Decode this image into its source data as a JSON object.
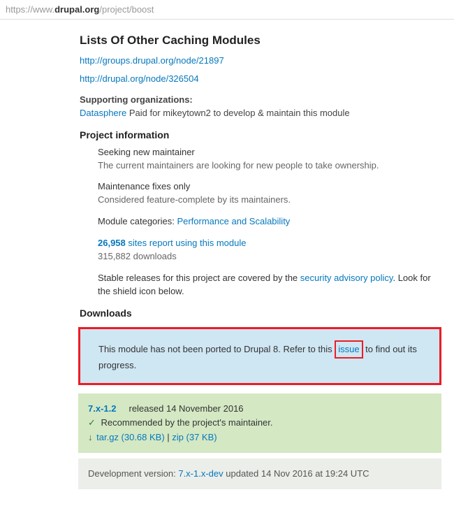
{
  "url": {
    "prefix": "https://www.",
    "domain": "drupal.org",
    "path": "/project/boost"
  },
  "headings": {
    "other_modules": "Lists Of Other Caching Modules",
    "project_info": "Project information",
    "downloads": "Downloads"
  },
  "links": {
    "other1": "http://groups.drupal.org/node/21897",
    "other2": "http://drupal.org/node/326504"
  },
  "supporting": {
    "label": "Supporting organizations:",
    "org": "Datasphere",
    "note": " Paid for mikeytown2 to develop & maintain this module"
  },
  "info": {
    "maintainer_title": "Seeking new maintainer",
    "maintainer_desc": "The current maintainers are looking for new people to take ownership.",
    "fixes_title": "Maintenance fixes only",
    "fixes_desc": "Considered feature-complete by its maintainers.",
    "categories_label": "Module categories: ",
    "category_link": "Performance and Scalability",
    "usage_number": "26,958",
    "usage_text": " sites report using this module",
    "downloads_count": "315,882 downloads",
    "security_pre": "Stable releases for this project are covered by the ",
    "security_link": "security advisory policy",
    "security_post": ". Look for the shield icon below."
  },
  "notice": {
    "pre": "This module has not been ported to Drupal 8. Refer to this ",
    "issue": "issue",
    "post": " to find out its progress."
  },
  "release": {
    "version": "7.x-1.2",
    "released": "released 14 November 2016",
    "recommended": " Recommended by the project's maintainer.",
    "tar_label": "tar.gz (30.68 KB)",
    "sep": "  |  ",
    "zip_label": "zip (37 KB)"
  },
  "dev": {
    "pre": "Development version: ",
    "version": "7.x-1.x-dev",
    "post": " updated 14 Nov 2016 at 19:24 UTC"
  }
}
